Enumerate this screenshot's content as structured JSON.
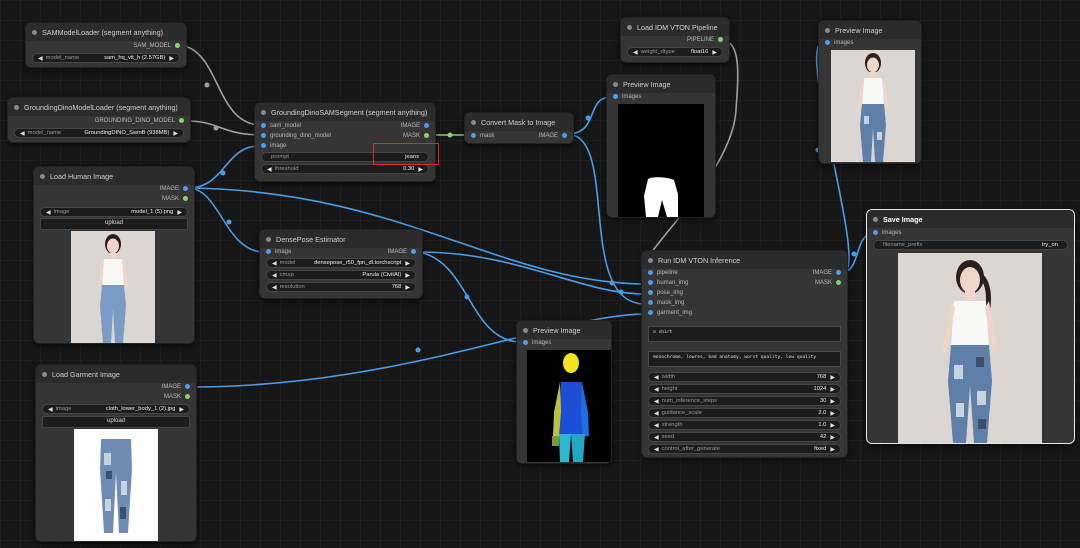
{
  "colors": {
    "canvas": "#161616",
    "node_body": "#353535",
    "node_title": "#2b2b2b",
    "wire_blue": "#4a9ee8",
    "wire_gray": "#9aa39a",
    "wire_green": "#7fd86b",
    "highlight": "#e12b2b"
  },
  "nodes": {
    "sam_loader": {
      "title": "SAMModelLoader (segment anything)",
      "output": "SAM_MODEL",
      "model_name_label": "model_name",
      "model_name_value": "sam_hq_vit_h (2.57GB)"
    },
    "dino_loader": {
      "title": "GroundingDinoModelLoader (segment anything)",
      "output": "GROUNDING_DINO_MODEL",
      "model_name_label": "model_name",
      "model_name_value": "GroundingDINO_SwinB (938MB)"
    },
    "dino_sam_segment": {
      "title": "GroundingDinoSAMSegment (segment anything)",
      "inputs": [
        "sam_model",
        "grounding_dino_model",
        "image"
      ],
      "outputs": [
        "IMAGE",
        "MASK"
      ],
      "prompt_label": "prompt",
      "prompt_value": "jeans",
      "threshold_label": "threshold",
      "threshold_value": "0.30"
    },
    "convert_mask": {
      "title": "Convert Mask to Image",
      "input": "mask",
      "output": "IMAGE"
    },
    "load_pipeline": {
      "title": "Load IDM VTON Pipeline",
      "output": "PIPELINE",
      "weight_dtype_label": "weight_dtype",
      "weight_dtype_value": "float16"
    },
    "preview_mask": {
      "title": "Preview Image",
      "input": "images"
    },
    "preview_result": {
      "title": "Preview Image",
      "input": "images"
    },
    "load_human": {
      "title": "Load Human Image",
      "outputs": [
        "IMAGE",
        "MASK"
      ],
      "image_label": "image",
      "image_value": "model_1 (5).png",
      "upload_label": "upload"
    },
    "densepose": {
      "title": "DensePose Estimator",
      "input": "image",
      "output": "IMAGE",
      "model_label": "model",
      "model_value": "densepose_r50_fpn_dl.torchscript",
      "cmap_label": "cmap",
      "cmap_value": "Parula (CivitAI)",
      "resolution_label": "resolution",
      "resolution_value": "768"
    },
    "run_vton": {
      "title": "Run IDM VTON Inference",
      "inputs": [
        "pipeline",
        "human_img",
        "pose_img",
        "mask_img",
        "garment_img"
      ],
      "outputs": [
        "IMAGE",
        "MASK"
      ],
      "positive_prompt": "a shirt",
      "negative_prompt": "monochrome, lowres, bad anatomy, worst quality, low quality",
      "params": [
        {
          "label": "width",
          "value": "768"
        },
        {
          "label": "height",
          "value": "1024"
        },
        {
          "label": "num_inference_steps",
          "value": "30"
        },
        {
          "label": "guidance_scale",
          "value": "2.0"
        },
        {
          "label": "strength",
          "value": "1.0"
        },
        {
          "label": "seed",
          "value": "42"
        },
        {
          "label": "control_after_generate",
          "value": "fixed"
        }
      ]
    },
    "preview_pose": {
      "title": "Preview Image",
      "input": "images"
    },
    "load_garment": {
      "title": "Load Garment Image",
      "outputs": [
        "IMAGE",
        "MASK"
      ],
      "image_label": "image",
      "image_value": "cloth_lower_body_1 (2).jpg",
      "upload_label": "upload"
    },
    "save_image": {
      "title": "Save Image",
      "input": "images",
      "filename_prefix_label": "filename_prefix",
      "filename_prefix_value": "try_on"
    }
  }
}
